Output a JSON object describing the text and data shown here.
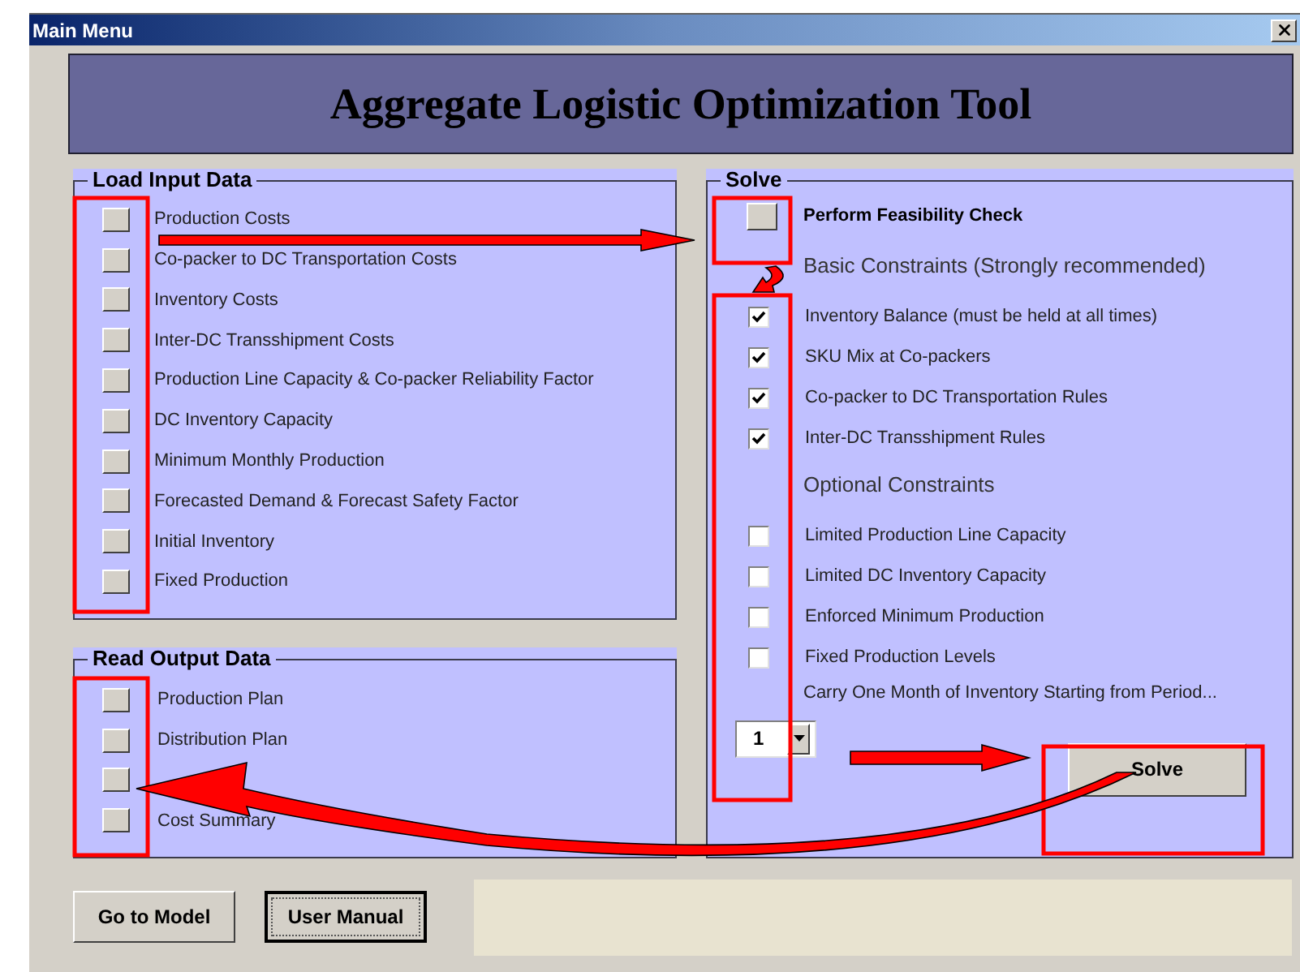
{
  "window": {
    "title": "Main Menu"
  },
  "banner": {
    "title": "Aggregate Logistic Optimization Tool"
  },
  "load_input": {
    "title": "Load Input Data",
    "items": [
      {
        "label": "Production Costs"
      },
      {
        "label": "Co-packer to DC Transportation Costs"
      },
      {
        "label": "Inventory Costs"
      },
      {
        "label": "Inter-DC Transshipment Costs"
      },
      {
        "label": "Production Line Capacity & Co-packer Reliability Factor"
      },
      {
        "label": "DC Inventory Capacity"
      },
      {
        "label": "Minimum Monthly Production"
      },
      {
        "label": "Forecasted Demand & Forecast Safety Factor"
      },
      {
        "label": "Initial Inventory"
      },
      {
        "label": "Fixed Production"
      }
    ]
  },
  "read_output": {
    "title": "Read Output Data",
    "items": [
      {
        "kind": "labeled",
        "label": "Production Plan"
      },
      {
        "kind": "labeled",
        "label": "Distribution Plan"
      },
      {
        "kind": "unlabeled"
      },
      {
        "kind": "labeled",
        "label": "Cost Summary"
      }
    ]
  },
  "solve": {
    "title": "Solve",
    "feasibility_check": {
      "label": "Perform Feasibility Check"
    },
    "basic_heading": "Basic Constraints (Strongly recommended)",
    "basic": [
      {
        "label": "Inventory Balance (must be held at all times)",
        "checked": true
      },
      {
        "label": "SKU Mix at Co-packers",
        "checked": true
      },
      {
        "label": "Co-packer to DC Transportation Rules",
        "checked": true
      },
      {
        "label": "Inter-DC Transshipment Rules",
        "checked": true
      }
    ],
    "optional_heading": "Optional Constraints",
    "optional": [
      {
        "label": "Limited Production Line Capacity",
        "checked": false
      },
      {
        "label": "Limited DC Inventory Capacity",
        "checked": false
      },
      {
        "label": "Enforced Minimum Production",
        "checked": false
      },
      {
        "label": "Fixed Production Levels",
        "checked": false
      }
    ],
    "carry_label": "Carry One Month of Inventory Starting from Period...",
    "period": {
      "value": "1"
    },
    "solve_button": "Solve"
  },
  "buttons": [
    {
      "label": "Go to Model",
      "focused": false
    },
    {
      "label": "User Manual",
      "focused": true
    }
  ]
}
